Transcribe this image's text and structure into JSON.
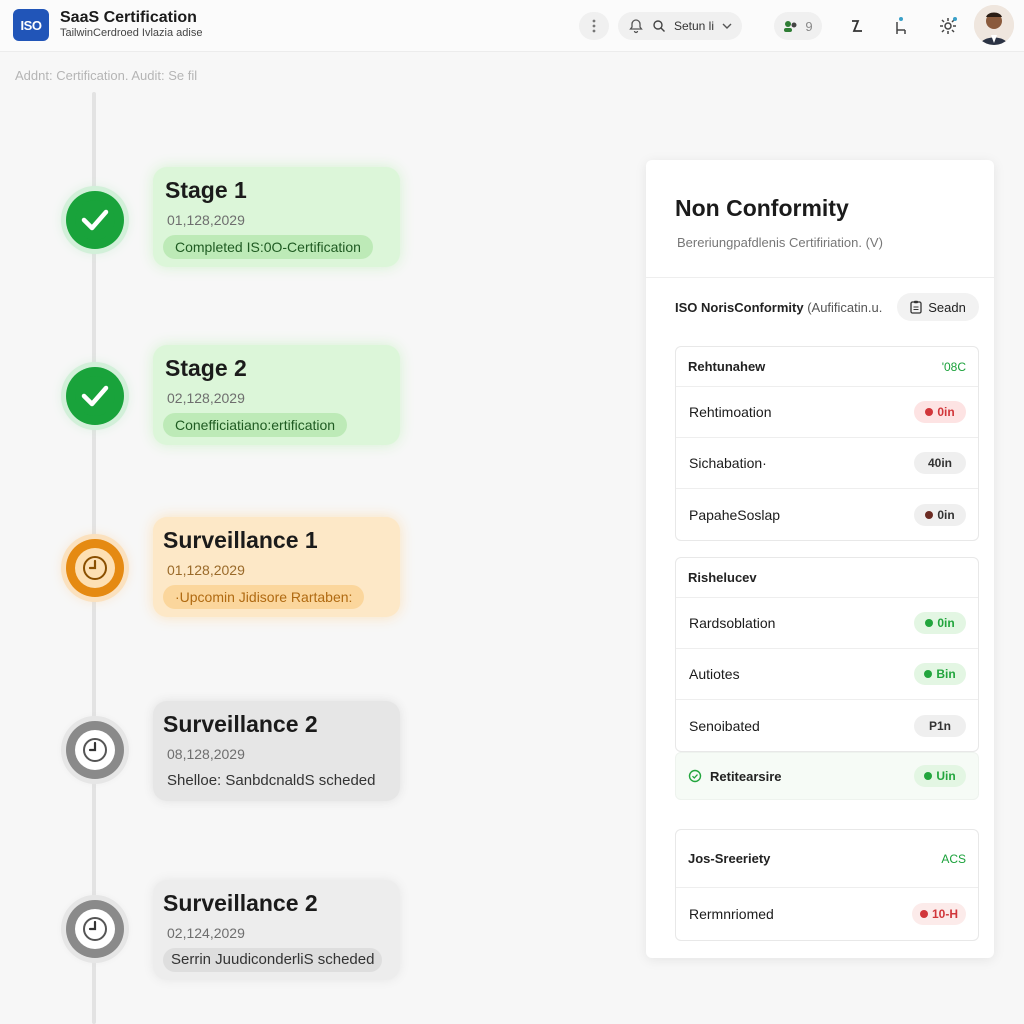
{
  "header": {
    "logo_text": "ISO",
    "title": "SaaS Certification",
    "subtitle": "TailwinCerdroed Ivlazia adise",
    "setup_label": "Setun li",
    "badge_count": "9"
  },
  "breadcrumb": "Addnt: Certification. Audit: Se fil",
  "timeline": [
    {
      "title": "Stage 1",
      "date": "01,128,2029",
      "status": "Completed IS:0O-Certification",
      "state": "completed"
    },
    {
      "title": "Stage 2",
      "date": "02,128,2029",
      "status": "Conefficiatiano:ertification",
      "state": "completed"
    },
    {
      "title": "Surveillance 1",
      "date": "01,128,2029",
      "status": "·Upcomin Jidisore Rartaben:",
      "state": "upcoming"
    },
    {
      "title": "Surveillance 2",
      "date": "08,128,2029",
      "status": "Shelloe: SanbdcnaldS scheded",
      "state": "scheduled"
    },
    {
      "title": "Surveillance 2",
      "date": "02,124,2029",
      "status": "Serrin JuudiconderliS scheded",
      "state": "scheduled"
    }
  ],
  "panel": {
    "title": "Non Conformity",
    "subtitle": "Bereriungpafdlenis Certifiriation. (V)",
    "filter_label": "ISO NorisConformity",
    "filter_muted": "(Aufificatin.u.",
    "search_label": "Seadn",
    "groups": [
      {
        "header": "Rehtunahew",
        "header_value": "'08C",
        "rows": [
          {
            "label": "Rehtimoation",
            "badge": "0in",
            "tone": "red"
          },
          {
            "label": "Sichabation·",
            "badge": "40in",
            "tone": "gray"
          },
          {
            "label": "PapaheSoslap",
            "badge": "0in",
            "tone": "gray"
          }
        ]
      },
      {
        "header": "Rishelucev",
        "header_value": "",
        "rows": [
          {
            "label": "Rardsoblation",
            "badge": "0in",
            "tone": "green"
          },
          {
            "label": "Autiotes",
            "badge": "Bin",
            "tone": "green"
          },
          {
            "label": "Senoibated",
            "badge": "P1n",
            "tone": "gray"
          }
        ]
      }
    ],
    "single": {
      "label": "Retitearsire",
      "badge": "Uin",
      "tone": "green"
    },
    "group3": {
      "header": "Jos-Sreeriety",
      "header_value": "ACS",
      "rows": [
        {
          "label": "Rermnriomed",
          "badge": "10-H",
          "tone": "red"
        }
      ]
    }
  },
  "colors": {
    "completed": "#19a33b",
    "upcoming": "#e58a12",
    "scheduled": "#8a8a8a",
    "brand": "#2155b8"
  }
}
